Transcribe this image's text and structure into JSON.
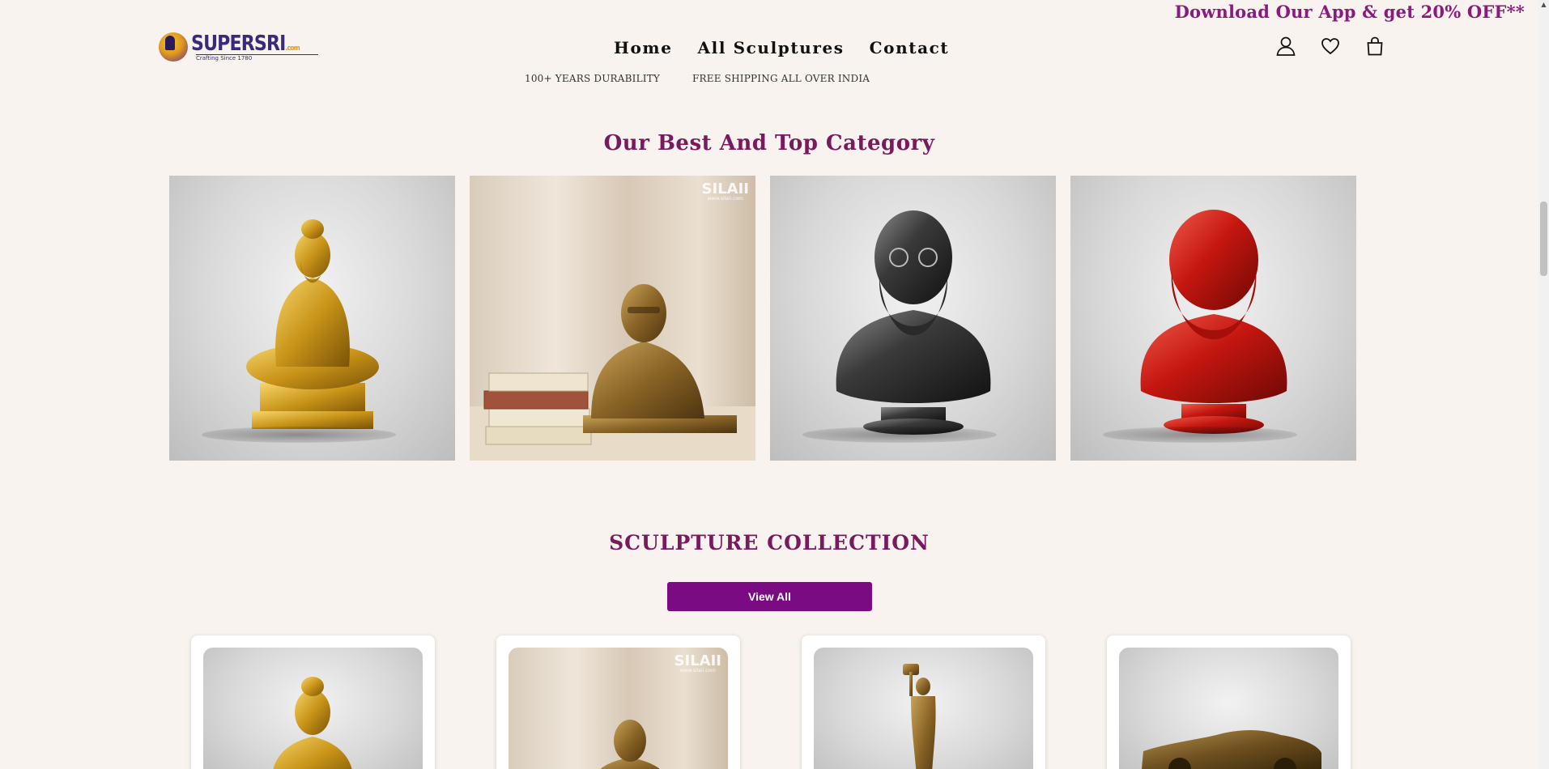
{
  "promo": {
    "text": "Download Our App & get 20% OFF**"
  },
  "logo": {
    "name": "SUPERSRI",
    "suffix": ".com",
    "tagline": "Crafting Since 1780"
  },
  "nav": {
    "items": [
      "Home",
      "All Sculptures",
      "Contact"
    ]
  },
  "header_icons": [
    "user-icon",
    "heart-icon",
    "bag-icon"
  ],
  "usp": {
    "items": [
      "100+ YEARS DURABILITY",
      "FREE SHIPPING ALL OVER INDIA"
    ]
  },
  "category_section": {
    "title": "Our Best And Top Category",
    "cards": [
      {
        "subject": "golden-seated-sage-statue",
        "finish": "gold",
        "watermark": ""
      },
      {
        "subject": "bronze-bust-with-books",
        "finish": "bronze",
        "watermark": "SILAII"
      },
      {
        "subject": "black-bearded-bust",
        "finish": "black",
        "watermark": ""
      },
      {
        "subject": "red-bearded-bust",
        "finish": "red",
        "watermark": ""
      }
    ]
  },
  "collection_section": {
    "title": "SCULPTURE COLLECTION",
    "view_all_label": "View All",
    "products": [
      {
        "subject": "golden-seated-sage-statue",
        "watermark": ""
      },
      {
        "subject": "bronze-bust",
        "watermark": "SILAII"
      },
      {
        "subject": "bronze-standing-figure",
        "watermark": ""
      },
      {
        "subject": "bronze-car-model",
        "watermark": ""
      }
    ]
  },
  "colors": {
    "accent": "#7b0b82",
    "title": "#7a1a5e",
    "promo": "#8b1a7e",
    "background": "#f8f3ee"
  }
}
